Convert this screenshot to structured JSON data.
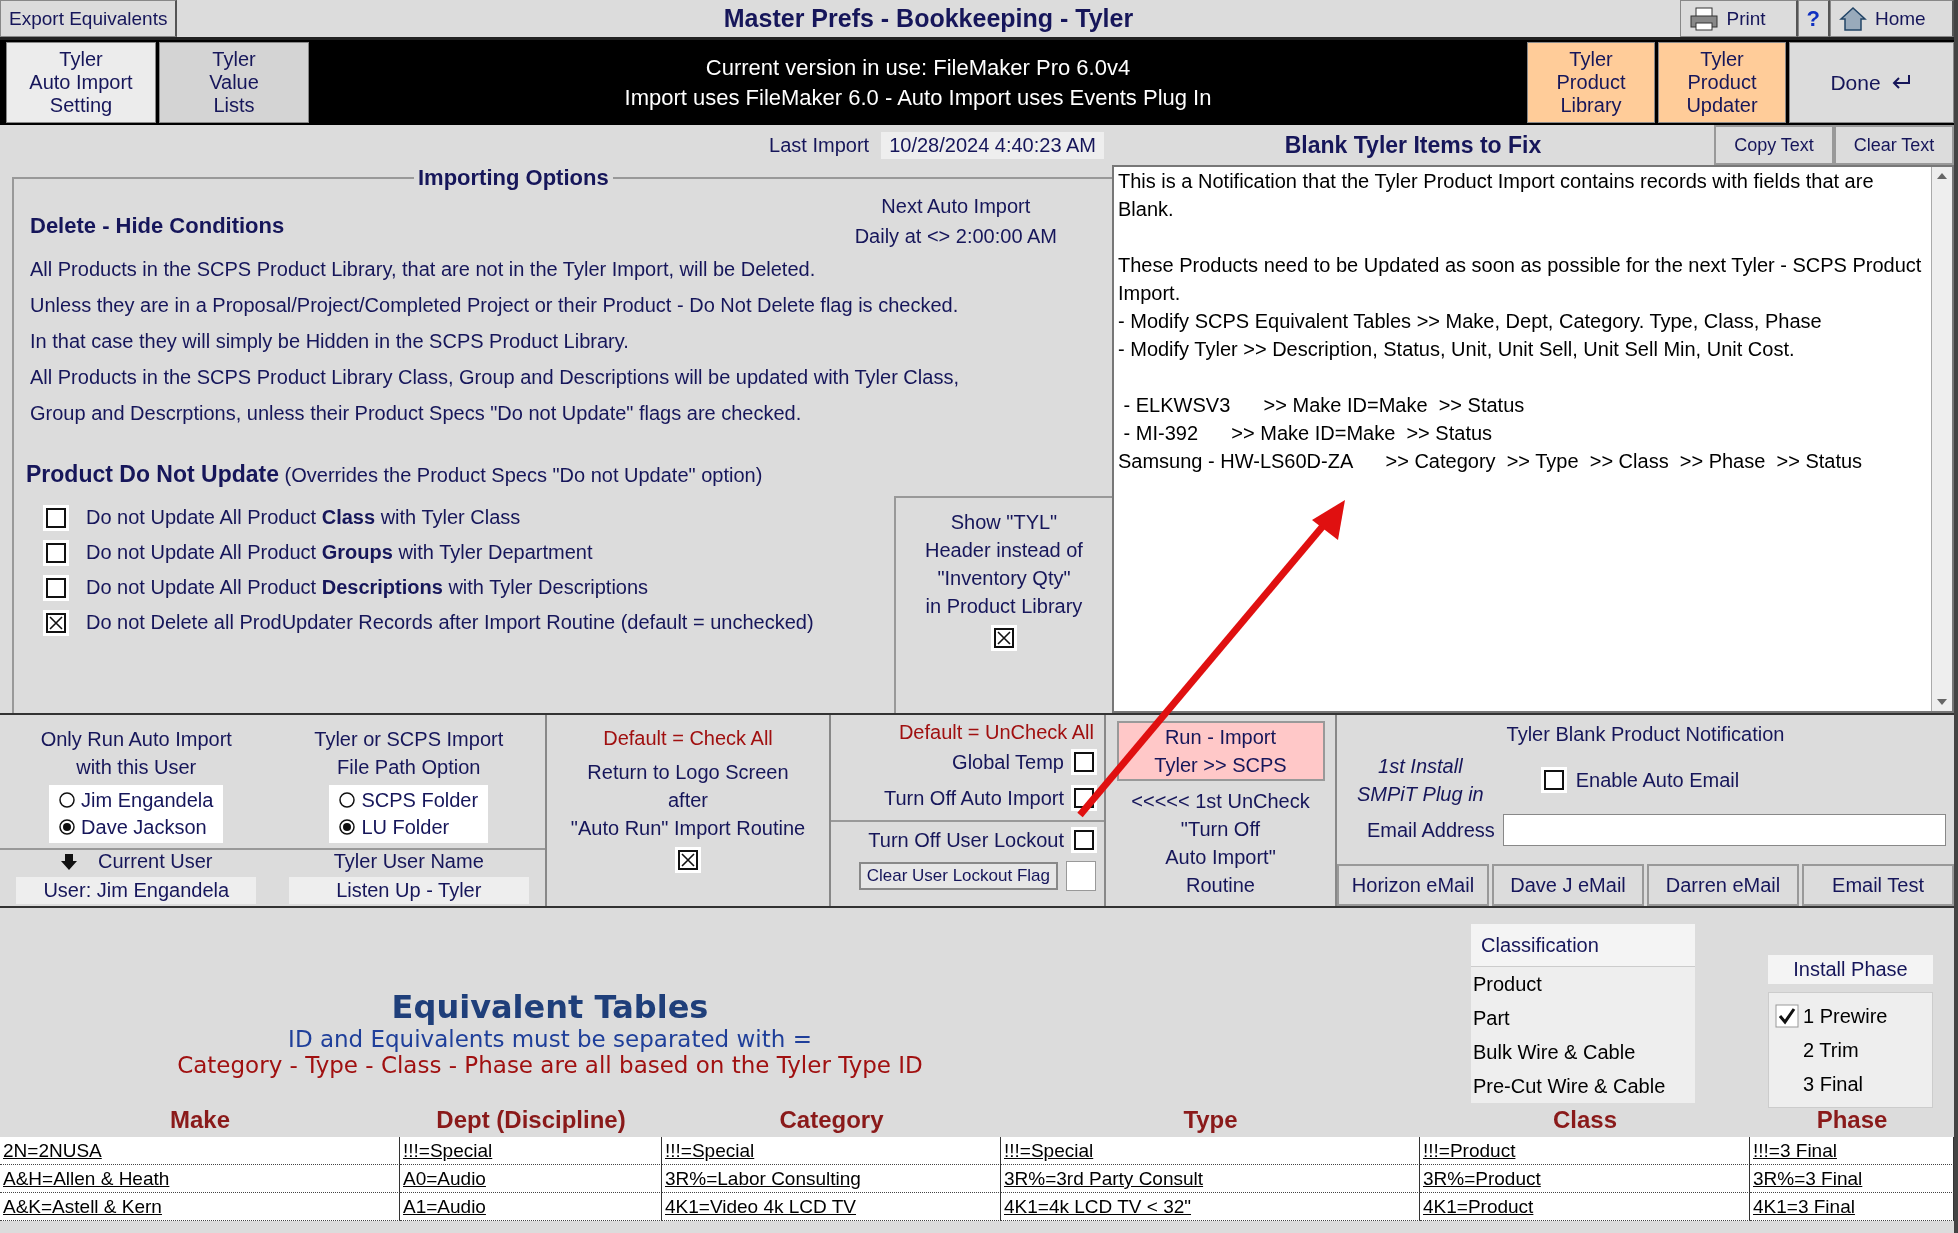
{
  "title_bar": {
    "export_button": "Export Equivalents",
    "title": "Master Prefs - Bookkeeping - Tyler",
    "print_button": "Print",
    "help_button": "?",
    "home_button": "Home"
  },
  "nav": {
    "left_tabs": [
      {
        "label": "Tyler\nAuto Import\nSetting",
        "selected": true
      },
      {
        "label": "Tyler\nValue\nLists",
        "selected": false
      }
    ],
    "version_lines": [
      "Current version in use:  FileMaker Pro 6.0v4",
      "Import uses FileMaker 6.0  -  Auto Import uses Events Plug In"
    ],
    "right_buttons": [
      "Tyler\nProduct\nLibrary",
      "Tyler\nProduct\nUpdater"
    ],
    "done_button": "Done"
  },
  "last_import": {
    "label": "Last Import",
    "value": "10/28/2024  4:40:23 AM"
  },
  "importing_options": {
    "title": "Importing Options",
    "next_auto_import": "Next Auto Import\nDaily at <> 2:00:00 AM",
    "delete_heading": "Delete - Hide Conditions",
    "delete_lines": [
      "All Products in the SCPS Product Library, that are not in the Tyler Import, will be Deleted.",
      "Unless they are in a Proposal/Project/Completed Project or their  Product - Do Not Delete flag is checked.",
      "In that case they will simply be Hidden in the SCPS Product Library.",
      "All Products in the SCPS Product Library Class, Group and Descriptions  will be updated with Tyler Class,",
      "Group and  Descrptions, unless their Product Specs \"Do not Update\" flags are checked."
    ],
    "do_not_update_heading": "Product Do Not Update",
    "do_not_update_note": "(Overrides the Product Specs \"Do not Update\" option)",
    "options": [
      {
        "label": "Do not Update All Product **Class** with Tyler Class",
        "checked": false
      },
      {
        "label": "Do not Update All Product **Groups** with Tyler Department",
        "checked": false
      },
      {
        "label": "Do not Update All Product **Descriptions** with Tyler Descriptions",
        "checked": false
      },
      {
        "label": "Do not Delete all ProdUpdater Records after Import Routine (default = unchecked)",
        "checked": true
      }
    ],
    "tyl_header": {
      "label": "Show \"TYL\"\nHeader instead of\n\"Inventory Qty\"\nin Product Library",
      "checked": true
    }
  },
  "blank_items": {
    "title": "Blank Tyler Items to Fix",
    "buttons": [
      "Copy Text",
      "Clear Text"
    ],
    "text": "This is a Notification that the Tyler Product Import contains records with fields that are Blank.\n\nThese Products need to be Updated as soon as possible for the next Tyler - SCPS Product Import.\n- Modify SCPS Equivalent Tables >> Make, Dept, Category. Type, Class, Phase\n- Modify Tyler >> Description, Status, Unit, Unit Sell, Unit Sell Min, Unit Cost.\n\n - ELKWSV3      >> Make ID=Make  >> Status\n - MI-392      >> Make ID=Make  >> Status\nSamsung - HW-LS60D-ZA      >> Category  >> Type  >> Class  >> Phase  >> Status"
  },
  "auto_import_user": {
    "label": "Only Run Auto Import\nwith this User",
    "options": [
      {
        "label": "Jim Engandela",
        "selected": false
      },
      {
        "label": "Dave Jackson",
        "selected": true
      }
    ]
  },
  "file_path": {
    "label": "Tyler or SCPS Import\nFile Path Option",
    "options": [
      {
        "label": "SCPS Folder",
        "selected": false
      },
      {
        "label": "LU Folder",
        "selected": true
      }
    ]
  },
  "current_user": {
    "label": "Current User",
    "value": "User: Jim Engandela"
  },
  "tyler_user_name": {
    "label": "Tyler User Name",
    "value": "Listen Up - Tyler"
  },
  "return_to_logo": {
    "default_note": "Default = Check All",
    "label": "Return to Logo Screen\nafter\n\"Auto Run\" Import Routine",
    "checked": true
  },
  "lockout": {
    "default_note": "Default = UnCheck All",
    "toggles": [
      {
        "label": "Global Temp",
        "checked": false
      },
      {
        "label": "Turn Off Auto Import",
        "checked": false
      },
      {
        "label": "Turn Off User Lockout",
        "checked": false
      }
    ],
    "clear_button": "Clear User Lockout Flag"
  },
  "run_import": {
    "button": "Run - Import\nTyler >> SCPS",
    "note": "<<<<< 1st UnCheck\n\"Turn Off\nAuto Import\"\nRoutine"
  },
  "notification": {
    "title": "Tyler Blank Product Notification",
    "install_note": "1st Install\nSMPiT Plug in",
    "enable_auto_email": {
      "label": "Enable Auto Email",
      "checked": false
    },
    "email_label": "Email Address",
    "email_buttons": [
      "Horizon eMail",
      "Dave J eMail",
      "Darren eMail",
      "Email Test"
    ]
  },
  "equivalent_tables": {
    "title": "Equivalent Tables",
    "subtitle": "ID and Equivalents must be separated with =",
    "note": "Category - Type - Class - Phase are all based on the Tyler Type ID",
    "classification": {
      "title": "Classification",
      "items": [
        "Product",
        "Part",
        "Bulk Wire & Cable",
        "Pre-Cut Wire & Cable"
      ]
    },
    "install_phase": {
      "title": "Install Phase",
      "items": [
        {
          "label": "1 Prewire",
          "checked": true
        },
        {
          "label": "2 Trim",
          "checked": false
        },
        {
          "label": "3 Final",
          "checked": false
        }
      ]
    },
    "columns": [
      "Make",
      "Dept (Discipline)",
      "Category",
      "Type",
      "Class",
      "Phase"
    ],
    "rows": [
      [
        "2N=2NUSA",
        "!!!=Special",
        "!!!=Special",
        "!!!=Special",
        "!!!=Product",
        "!!!=3 Final"
      ],
      [
        "A&H=Allen & Heath",
        "A0=Audio",
        "3R%=Labor Consulting",
        "3R%=3rd Party Consult",
        "3R%=Product",
        "3R%=3 Final"
      ],
      [
        "A&K=Astell & Kern",
        "A1=Audio",
        "4K1=Video 4k LCD TV",
        "4K1=4k LCD TV < 32\"",
        "4K1=Product",
        "4K1=3 Final"
      ]
    ]
  }
}
